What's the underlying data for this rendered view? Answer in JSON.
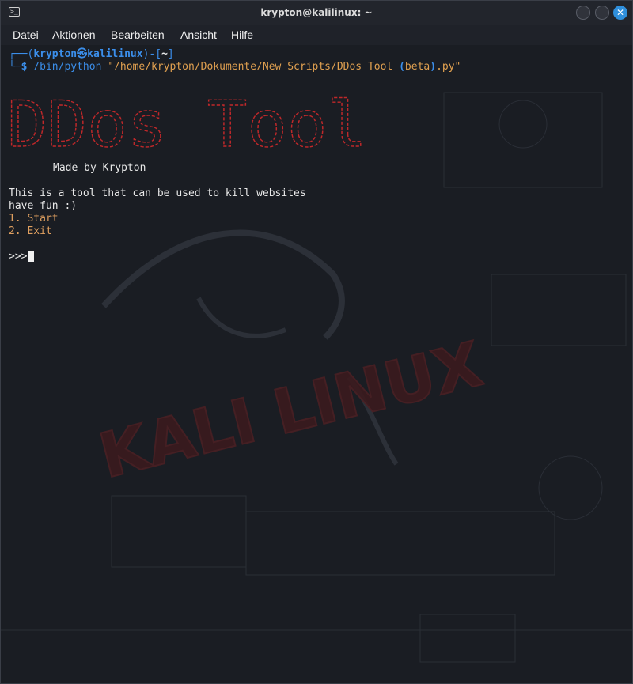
{
  "window": {
    "title": "krypton@kalilinux: ~"
  },
  "menu": [
    "Datei",
    "Aktionen",
    "Bearbeiten",
    "Ansicht",
    "Hilfe"
  ],
  "prompt": {
    "open_bracket": "┌──(",
    "user": "krypton",
    "at": "㉿",
    "host": "kalilinux",
    "mid": ")-[",
    "dir": "~",
    "close": "]",
    "line2_prefix": "└─",
    "dollar": "$",
    "cmd": "/bin/python",
    "arg_start": "\"/home/krypton/Dokumente/New Scripts/DDos Tool ",
    "arg_paren_open": "(",
    "arg_beta": "beta",
    "arg_paren_close": ")",
    "arg_end": ".py\""
  },
  "banner": {
    "text": "DDos Tool",
    "color": "#c0282a"
  },
  "output": {
    "made_by": "Made by Krypton",
    "line1": "This is a tool that can be used to kill websites",
    "line2": "have fun :)",
    "option1": "1. Start",
    "option2": "2. Exit",
    "input_prompt": ">>>"
  },
  "colors": {
    "accent": "#3b8eea",
    "close_button": "#2f8fdc",
    "menu_option": "#e0a060",
    "banner": "#c0282a"
  }
}
